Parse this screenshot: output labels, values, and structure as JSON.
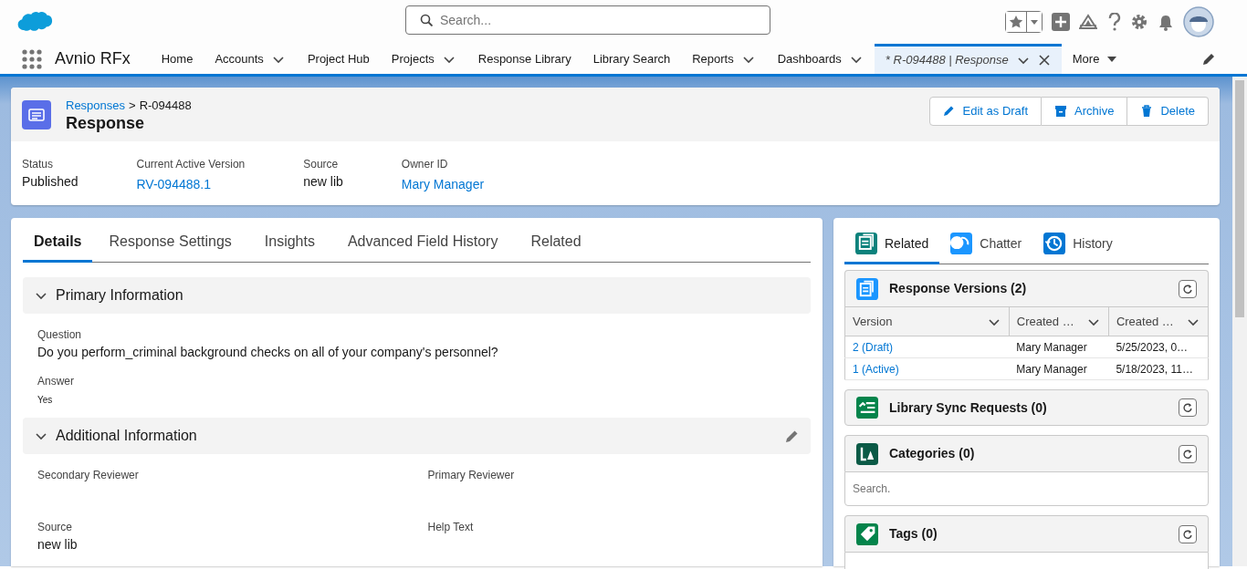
{
  "header": {
    "search": {
      "placeholder": "Search..."
    }
  },
  "nav": {
    "app_name": "Avnio RFx",
    "items": [
      {
        "kind": "link",
        "label": "Home",
        "has_menu": false,
        "selected": false
      },
      {
        "kind": "link",
        "label": "Accounts",
        "has_menu": true,
        "selected": false
      },
      {
        "kind": "link",
        "label": "Project Hub",
        "has_menu": false,
        "selected": false
      },
      {
        "kind": "link",
        "label": "Projects",
        "has_menu": true,
        "selected": false
      },
      {
        "kind": "link",
        "label": "Response Library",
        "has_menu": false,
        "selected": false
      },
      {
        "kind": "link",
        "label": "Library Search",
        "has_menu": false,
        "selected": false
      },
      {
        "kind": "link",
        "label": "Reports",
        "has_menu": true,
        "selected": false
      },
      {
        "kind": "link",
        "label": "Dashboards",
        "has_menu": true,
        "selected": false
      },
      {
        "kind": "workspace_tab",
        "label": "* R-094488 | Response",
        "has_menu": true,
        "selected": true
      },
      {
        "kind": "more",
        "label": "More",
        "has_menu": true,
        "selected": false
      }
    ]
  },
  "record": {
    "breadcrumb": {
      "parent": "Responses",
      "separator": ">",
      "current": "R-094488"
    },
    "title": "Response",
    "actions": [
      {
        "kind": "edit",
        "label": "Edit as Draft"
      },
      {
        "kind": "archive",
        "label": "Archive"
      },
      {
        "kind": "delete",
        "label": "Delete"
      }
    ],
    "highlights": [
      {
        "label": "Status",
        "value": "Published",
        "link": false
      },
      {
        "label": "Current Active Version",
        "value": "RV-094488.1",
        "link": true
      },
      {
        "label": "Source",
        "value": "new lib",
        "link": false
      },
      {
        "label": "Owner ID",
        "value": "Mary Manager",
        "link": true
      }
    ]
  },
  "details": {
    "tabs": [
      {
        "label": "Details",
        "selected": true
      },
      {
        "label": "Response Settings",
        "selected": false
      },
      {
        "label": "Insights",
        "selected": false
      },
      {
        "label": "Advanced Field History",
        "selected": false
      },
      {
        "label": "Related",
        "selected": false
      }
    ],
    "sections": [
      {
        "title": "Primary Information",
        "expanded": true,
        "editable": false,
        "kind": "one_column",
        "fields": [
          {
            "label": "Question",
            "value": "Do you perform_criminal background checks on all of your company's personnel?",
            "kind": "text"
          },
          {
            "label": "Answer",
            "value": "Yes",
            "kind": "rich_text"
          }
        ]
      },
      {
        "title": "Additional Information",
        "expanded": true,
        "editable": true,
        "kind": "two_column",
        "fields": [
          {
            "label": "Secondary Reviewer"
          },
          {
            "label": "Primary Reviewer"
          },
          {
            "label": "Source",
            "value": "new lib",
            "kind": "text"
          },
          {
            "label": "Help Text"
          }
        ]
      }
    ]
  },
  "side": {
    "tabs": [
      {
        "kind": "related",
        "label": "Related",
        "selected": true
      },
      {
        "kind": "chatter",
        "label": "Chatter",
        "selected": false
      },
      {
        "kind": "history",
        "label": "History",
        "selected": false
      }
    ],
    "related_lists": [
      {
        "kind": "versions",
        "title": "Response Versions (2)",
        "has_search": false,
        "table": {
          "columns": [
            {
              "label": "Version"
            },
            {
              "label": "Created …"
            },
            {
              "label": "Created …"
            }
          ],
          "rows": [
            {
              "cells": [
                {
                  "text": "2 (Draft)",
                  "link": true
                },
                {
                  "text": "Mary Manager",
                  "link": false
                },
                {
                  "text": "5/25/2023, 0…",
                  "link": false
                }
              ]
            },
            {
              "cells": [
                {
                  "text": "1 (Active)",
                  "link": true
                },
                {
                  "text": "Mary Manager",
                  "link": false
                },
                {
                  "text": "5/18/2023, 11…",
                  "link": false
                }
              ]
            }
          ]
        }
      },
      {
        "kind": "sync",
        "title": "Library Sync Requests (0)",
        "has_search": false
      },
      {
        "kind": "categories",
        "title": "Categories (0)",
        "has_search": true,
        "search_placeholder": "Search."
      },
      {
        "kind": "tags",
        "title": "Tags (0)",
        "has_search": true
      }
    ]
  }
}
